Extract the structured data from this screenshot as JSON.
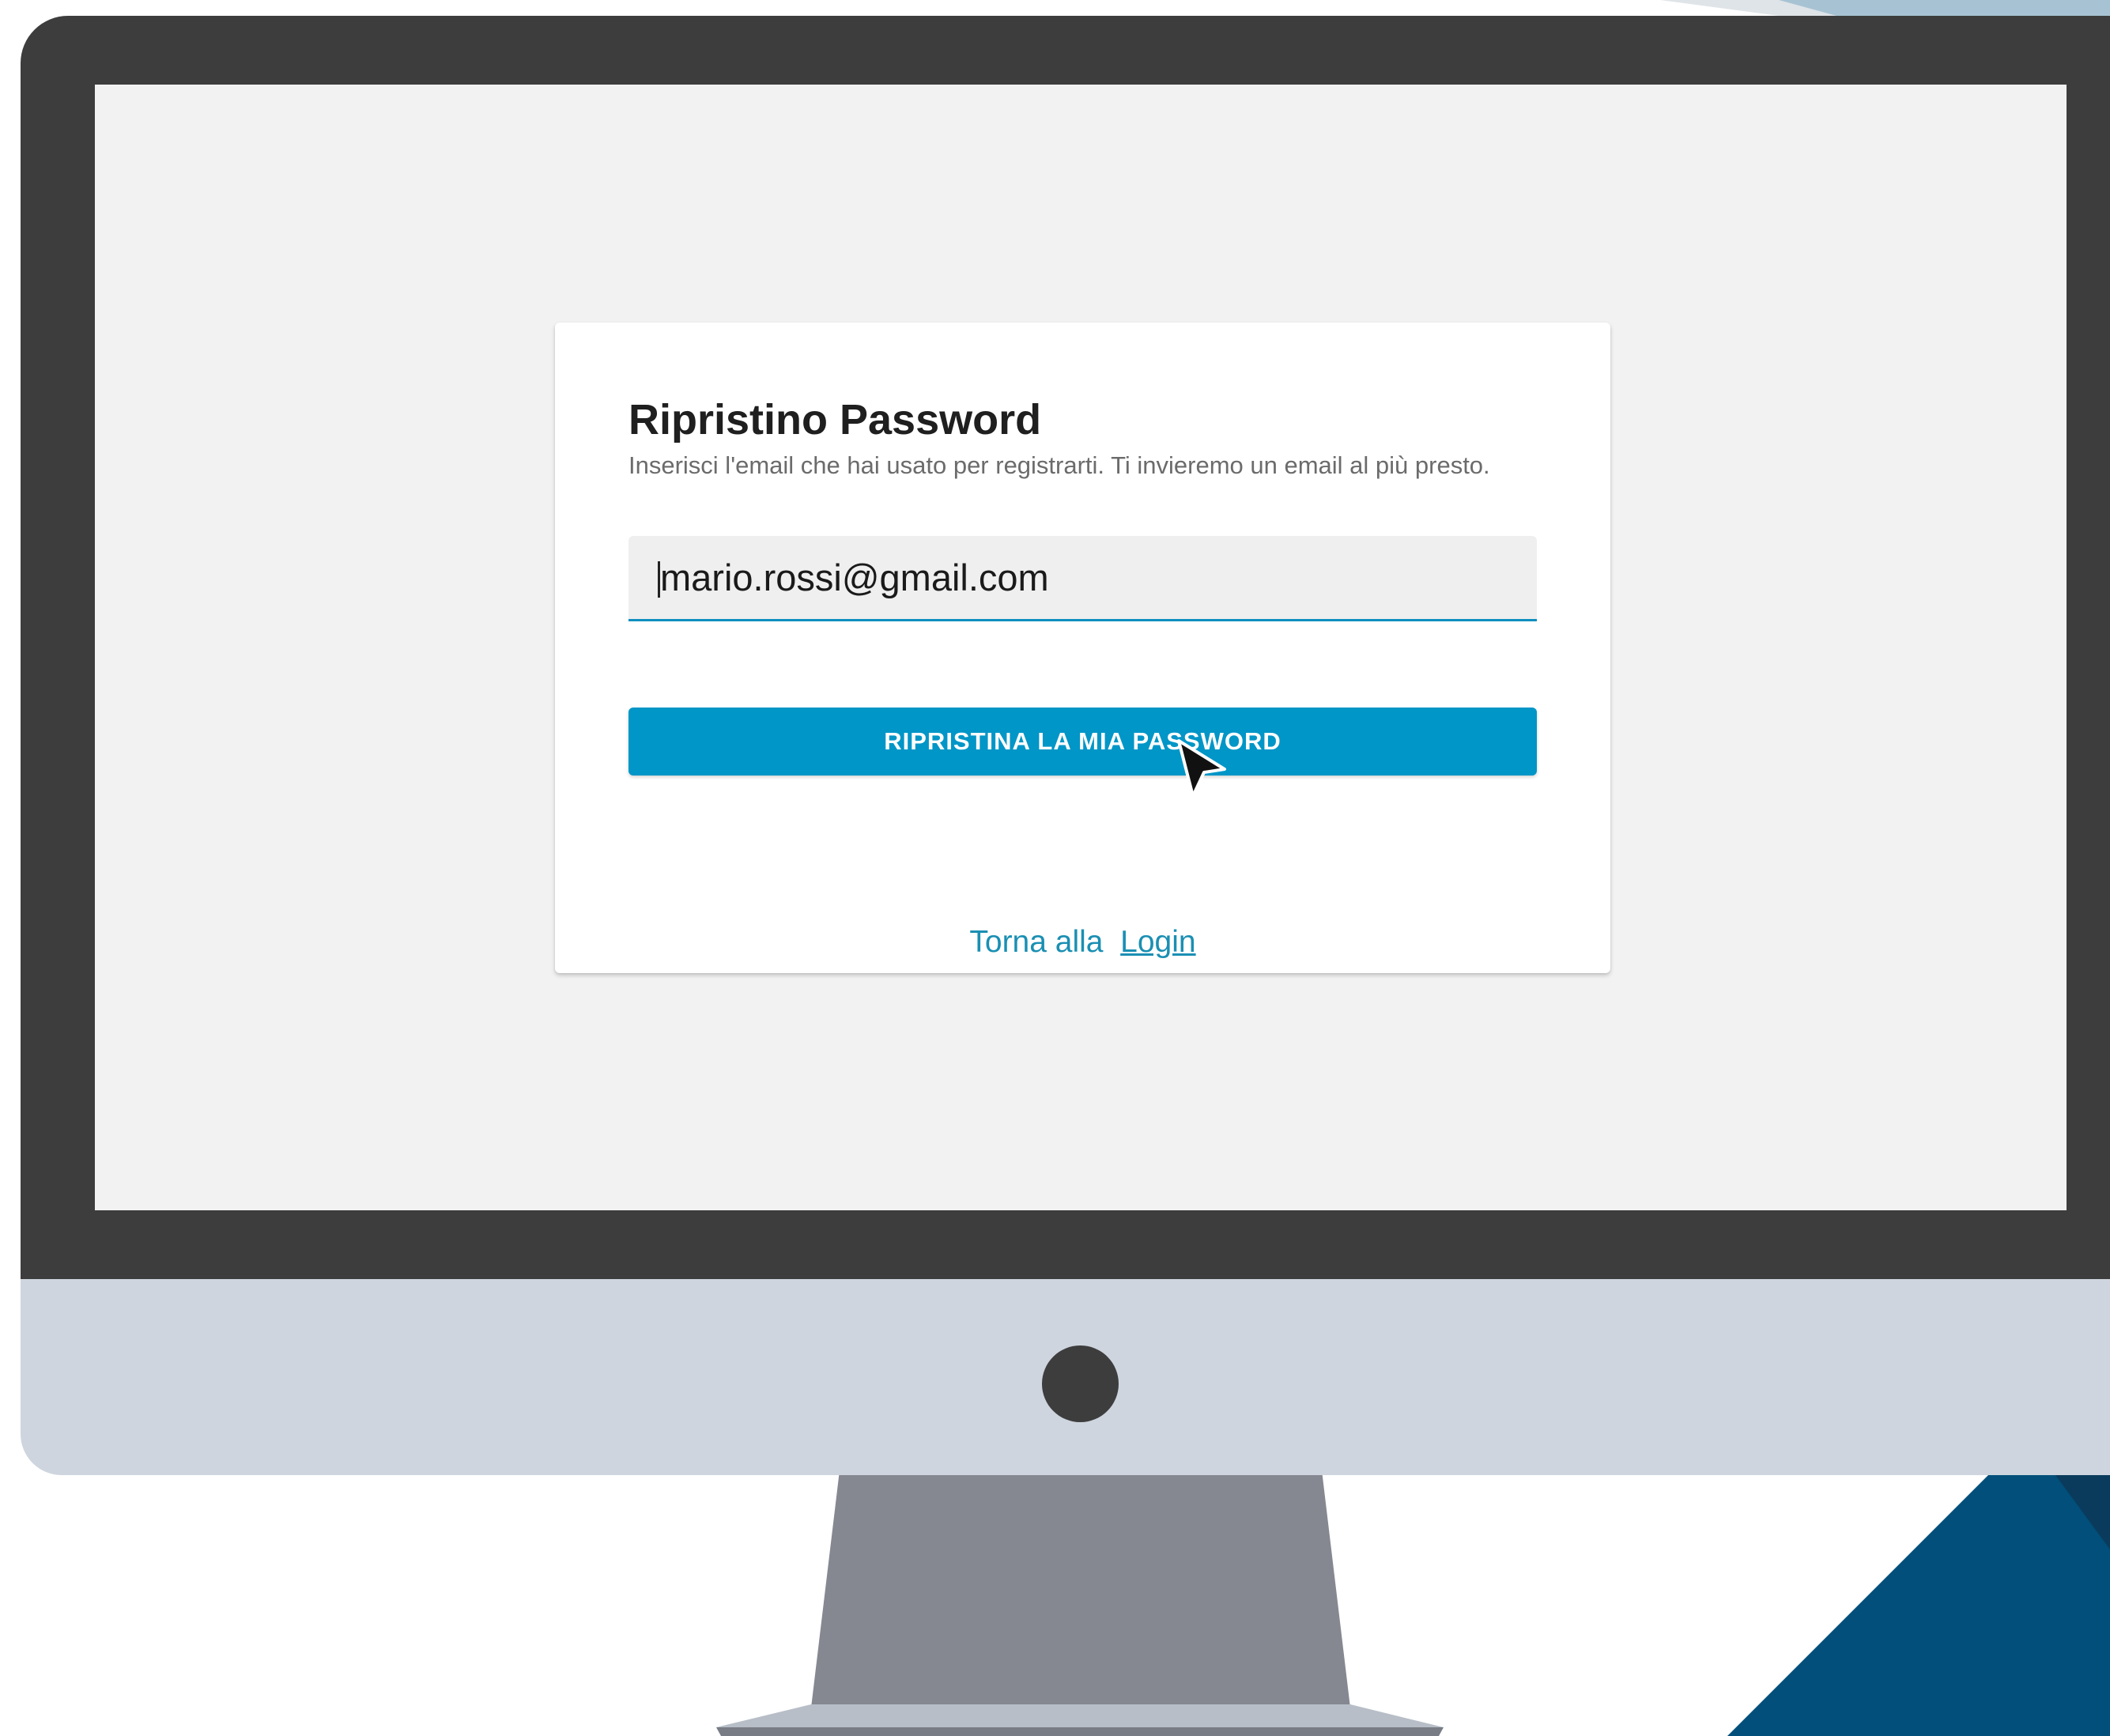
{
  "reset_form": {
    "title": "Ripristino Password",
    "subtitle": "Inserisci l'email che hai usato per registrarti. Ti invieremo un email al più presto.",
    "email_value": "mario.rossi@gmail.com",
    "submit_label": "RIPRISTINA LA MIA PASSWORD",
    "back_text": "Torna alla",
    "login_link": "Login"
  },
  "colors": {
    "accent": "#0096c7",
    "link": "#1a8fb3",
    "screen_bg": "#f2f2f2",
    "monitor_bezel": "#3d3d3d",
    "monitor_chin": "#ced5de",
    "stand": "#858891",
    "background_blue": "#004f7c"
  },
  "icons": {
    "pointer": "mouse-pointer-icon"
  }
}
